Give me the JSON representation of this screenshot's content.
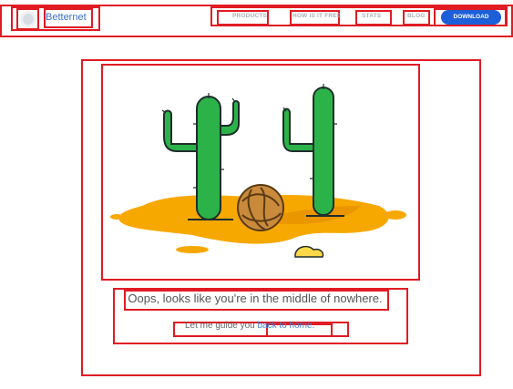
{
  "header": {
    "brand": "Betternet",
    "nav": [
      "PRODUCTS",
      "HOW IS IT FREE",
      "STATS",
      "BLOG"
    ],
    "download_label": "DOWNLOAD"
  },
  "main": {
    "illustration_icon": "cactus-404-illustration",
    "message": "Oops, looks like you're in the middle of nowhere.",
    "guide_prefix": "Let me guide you ",
    "guide_link": "back to home."
  },
  "colors": {
    "accent": "#1d5fd9",
    "link": "#4a7fd4",
    "annotation": "#e01b24",
    "cactus": "#2bb34a",
    "sand": "#f7a800"
  }
}
